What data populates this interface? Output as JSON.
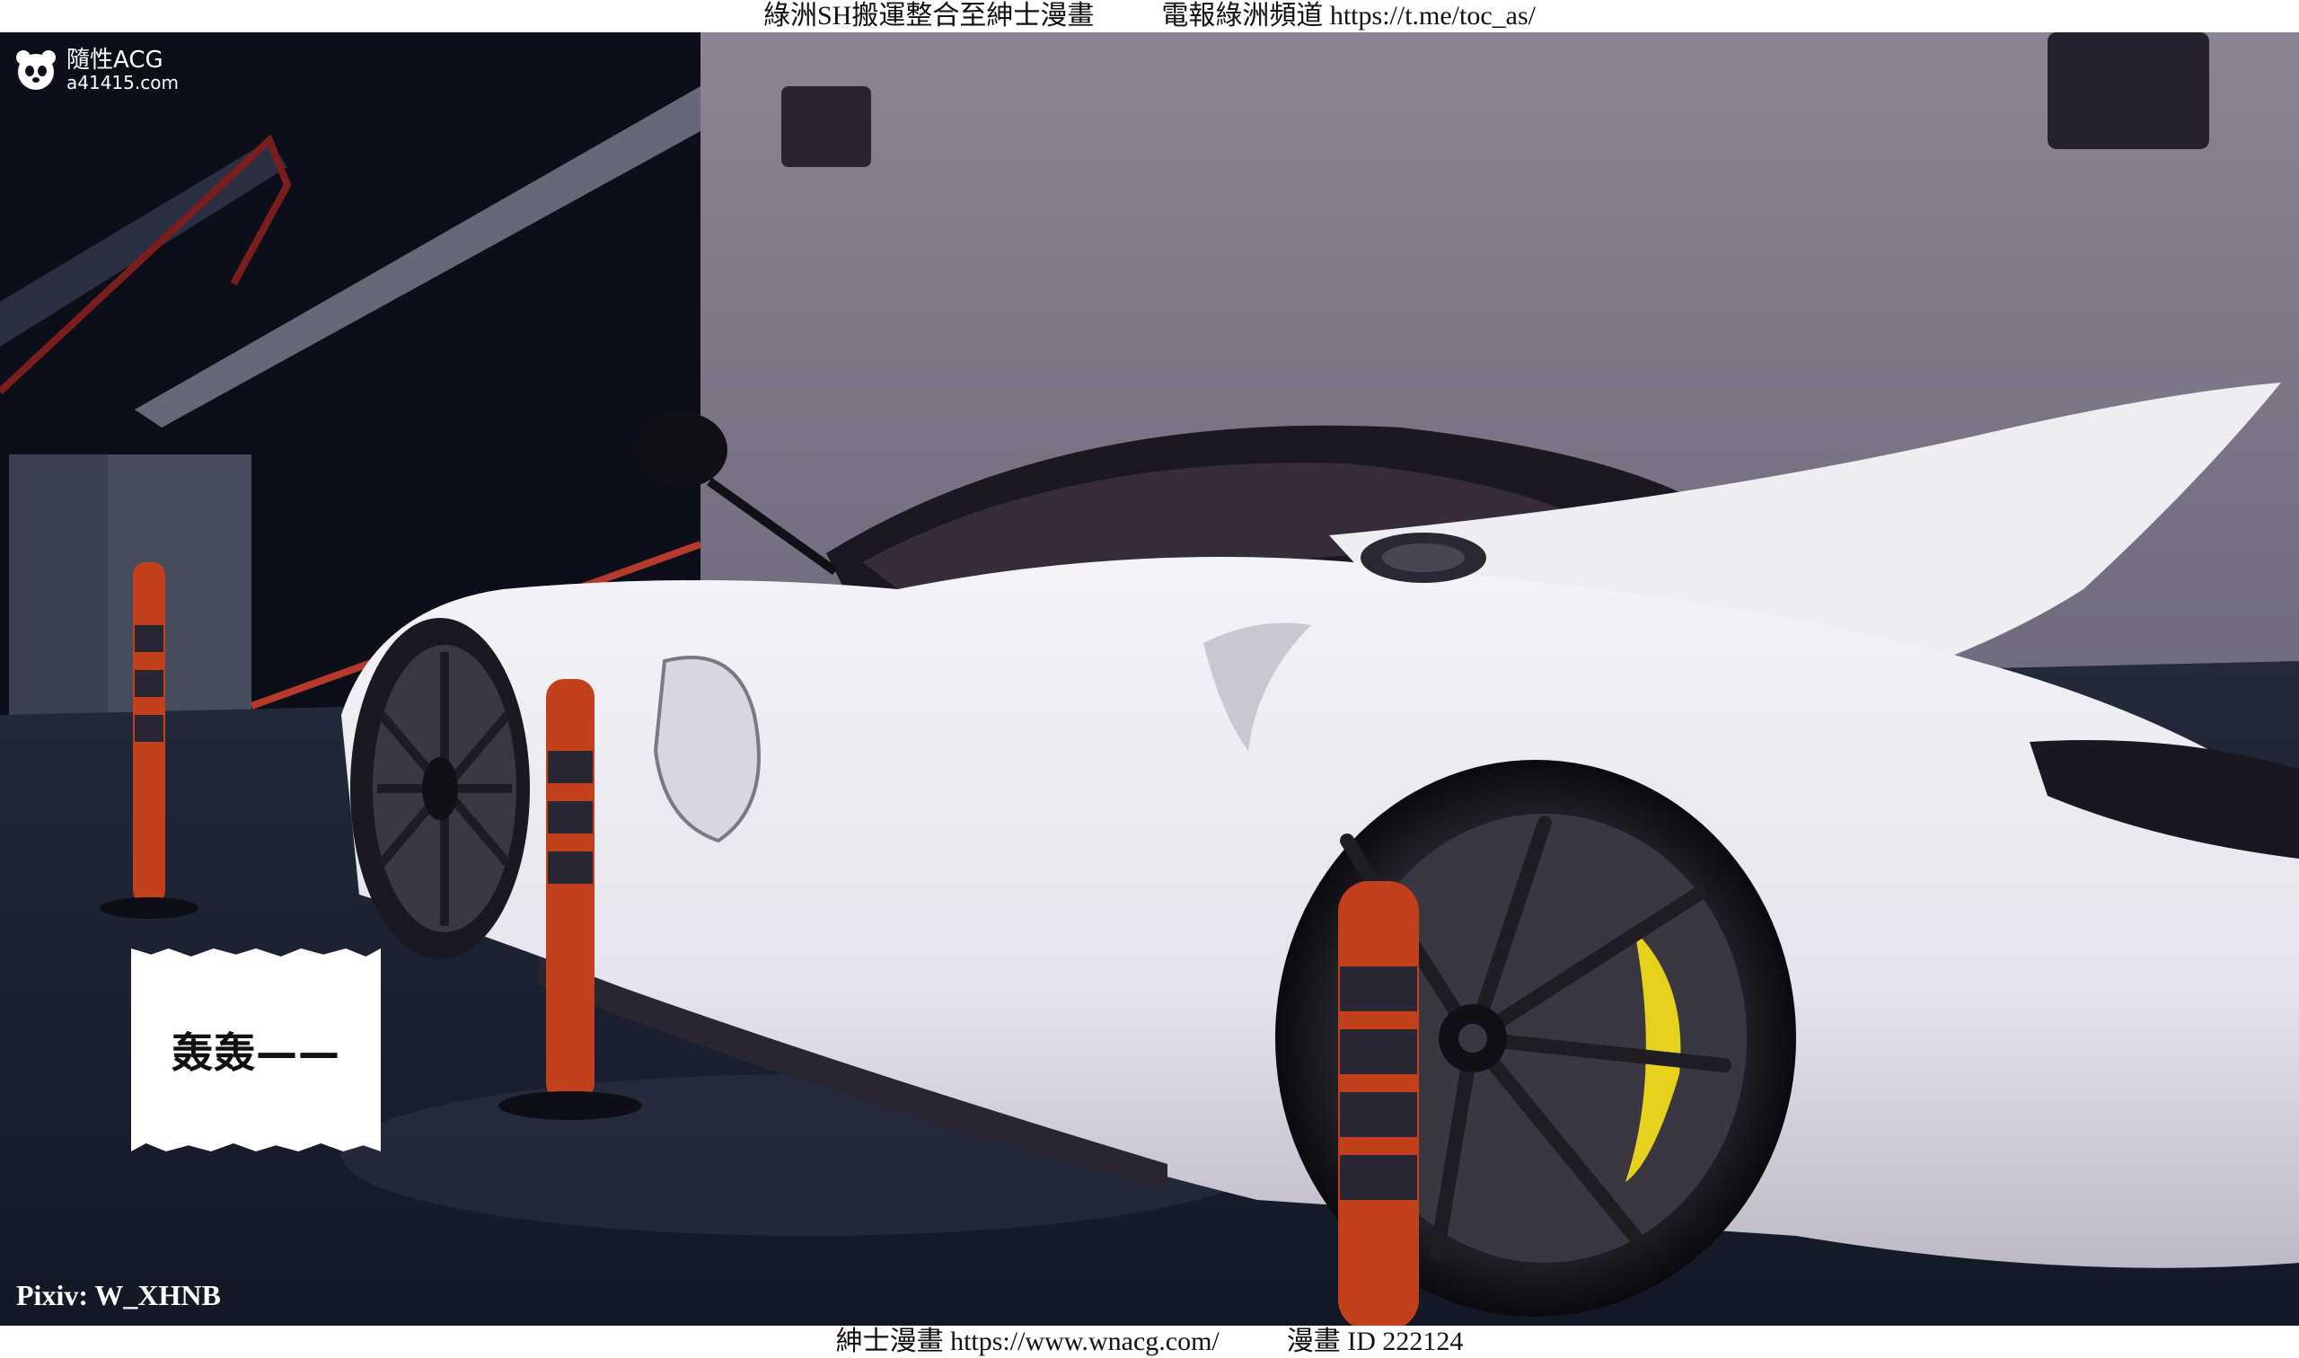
{
  "top_caption": "綠洲SH搬運整合至紳士漫畫          電報綠洲頻道 https://t.me/toc_as/",
  "bottom_caption": "紳士漫畫 https://www.wnacg.com/          漫畫 ID 222124",
  "watermark": {
    "name": "隨性ACG",
    "url": "a41415.com",
    "icon": "panda-icon"
  },
  "sound_effect": "轰轰——",
  "credit": "Pixiv: W_XHNB",
  "colors": {
    "car_body": "#eceaf0",
    "wall": "#8f8797",
    "bollard_orange": "#c2401b",
    "caliper": "#e6d21c",
    "floor": "#1c2333"
  }
}
